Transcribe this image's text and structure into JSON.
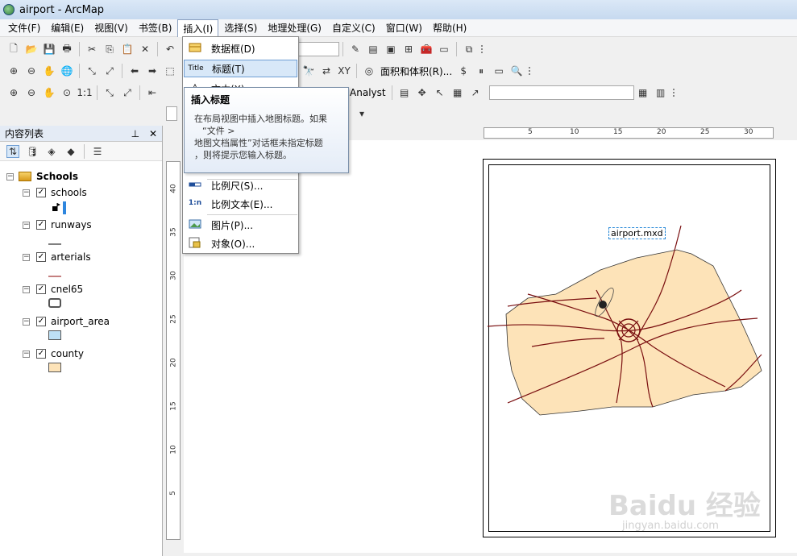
{
  "window": {
    "title": "airport - ArcMap"
  },
  "menubar": [
    {
      "label": "文件(F)"
    },
    {
      "label": "编辑(E)"
    },
    {
      "label": "视图(V)"
    },
    {
      "label": "书签(B)"
    },
    {
      "label": "插入(I)",
      "active": true
    },
    {
      "label": "选择(S)"
    },
    {
      "label": "地理处理(G)"
    },
    {
      "label": "自定义(C)"
    },
    {
      "label": "窗口(W)"
    },
    {
      "label": "帮助(H)"
    }
  ],
  "toolbar": {
    "area_volume_label": "面积和体积(R)...",
    "network_analyst_label": "ork Analyst"
  },
  "insert_menu": {
    "items": [
      {
        "label": "数据框(D)",
        "icon": "data-frame-icon"
      },
      {
        "label": "标题(T)",
        "icon": "title-icon",
        "highlighted": true
      },
      {
        "label": "文本(X)",
        "icon": "text-icon"
      },
      {
        "label": "比例尺(S)...",
        "icon": "scale-bar-icon"
      },
      {
        "label": "比例文本(E)...",
        "icon": "scale-text-icon"
      },
      {
        "label": "图片(P)...",
        "icon": "picture-icon"
      },
      {
        "label": "对象(O)...",
        "icon": "object-icon"
      }
    ],
    "title_icon_text": "Title",
    "scale_text_icon_text": "1:n"
  },
  "tooltip": {
    "title": "插入标题",
    "lines": [
      "在布局视图中插入地图标题。如果",
      "“文件 >",
      "地图文档属性”对话框未指定标题",
      "，则将提示您输入标题。"
    ]
  },
  "toc": {
    "header": "内容列表",
    "pin": "ᵖ",
    "close": "✕",
    "data_frame": "Schools",
    "layers": [
      {
        "name": "schools",
        "symbol": "point"
      },
      {
        "name": "runways",
        "symbol": "line",
        "color": "#000000"
      },
      {
        "name": "arterials",
        "symbol": "line",
        "color": "#8b0000"
      },
      {
        "name": "cnel65",
        "symbol": "hollow-polygon",
        "color": "#555555"
      },
      {
        "name": "airport_area",
        "symbol": "polygon",
        "color": "#bee0f5"
      },
      {
        "name": "county",
        "symbol": "polygon",
        "color": "#fde3b8"
      }
    ]
  },
  "rulers": {
    "horizontal": [
      "5",
      "10",
      "15",
      "20",
      "25",
      "30"
    ],
    "vertical": [
      "40",
      "35",
      "30",
      "25",
      "20",
      "15",
      "10",
      "5"
    ]
  },
  "layout": {
    "map_title": "airport.mxd",
    "county_color": "#fde3b8",
    "road_color": "#7a0f10"
  },
  "watermark": {
    "brand": "Baidu 经验",
    "url": "jingyan.baidu.com"
  }
}
